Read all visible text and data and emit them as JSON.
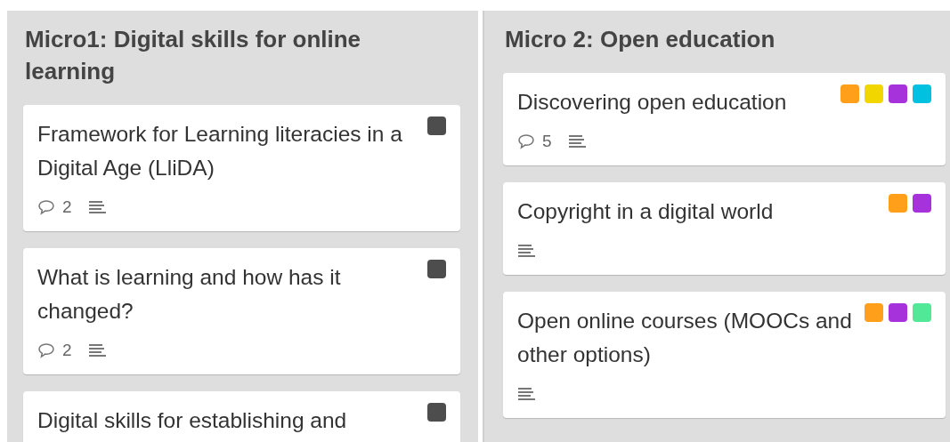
{
  "lists": [
    {
      "title": "Micro1: Digital skills for online learning",
      "cards": [
        {
          "title": "Framework for Learning literacies in a Digital Age (LliDA)",
          "labels": [
            {
              "color": "#4d4d4d"
            }
          ],
          "comments": "2",
          "has_description": true
        },
        {
          "title": "What is learning and how has it changed?",
          "labels": [
            {
              "color": "#4d4d4d"
            }
          ],
          "comments": "2",
          "has_description": true
        },
        {
          "title": "Digital skills for establishing and",
          "labels": [
            {
              "color": "#4d4d4d"
            }
          ]
        }
      ]
    },
    {
      "title": "Micro 2: Open education",
      "cards": [
        {
          "title": "Discovering open education",
          "labels": [
            {
              "color": "#ff9f1a"
            },
            {
              "color": "#f2d600"
            },
            {
              "color": "#a632db"
            },
            {
              "color": "#00c2e0"
            }
          ],
          "comments": "5",
          "has_description": true
        },
        {
          "title": "Copyright in a digital world",
          "labels": [
            {
              "color": "#ff9f1a"
            },
            {
              "color": "#a632db"
            }
          ],
          "has_description": true
        },
        {
          "title": "Open online courses (MOOCs and other options)",
          "labels": [
            {
              "color": "#ff9f1a"
            },
            {
              "color": "#a632db"
            },
            {
              "color": "#51e898"
            }
          ],
          "has_description": true
        }
      ]
    }
  ]
}
